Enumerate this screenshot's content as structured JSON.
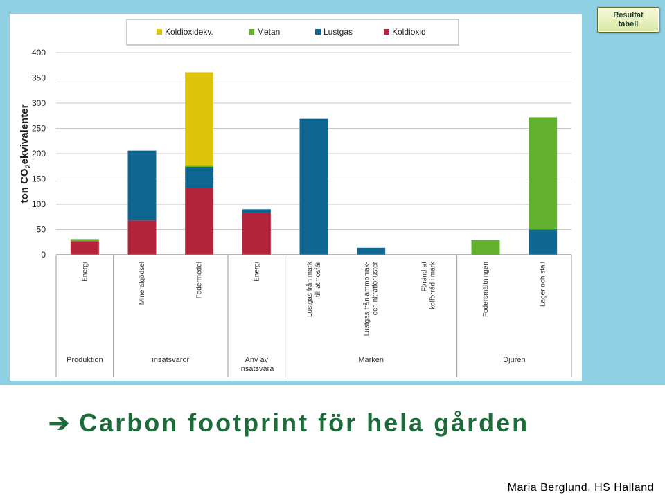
{
  "button": {
    "label": "Resultat\ntabell"
  },
  "slide": {
    "title_arrow": "➔",
    "title": "Carbon footprint för hela gården",
    "author": "Maria Berglund, HS Halland"
  },
  "chart_data": {
    "type": "bar",
    "stacked": true,
    "ylabel_prefix": "ton CO",
    "ylabel_sub": "2",
    "ylabel_suffix": "ekvivalenter",
    "ylim": [
      0,
      400
    ],
    "yticks": [
      0,
      50,
      100,
      150,
      200,
      250,
      300,
      350,
      400
    ],
    "grid": true,
    "legend_position": "top",
    "categories": [
      "Energi",
      "Mineralgödsel",
      "Fodermedel",
      "Energi",
      "Lustgas från mark till atmosfär",
      "Lustgas från ammoniak- och nitratförluster",
      "Förändrat kolförråd i mark",
      "Fodersmältningen",
      "Lager och stall"
    ],
    "category_lines": [
      [
        "Energi"
      ],
      [
        "Mineralgödsel"
      ],
      [
        "Fodermedel"
      ],
      [
        "Energi"
      ],
      [
        "Lustgas från mark",
        "till atmosfär"
      ],
      [
        "Lustgas från ammoniak-",
        "och nitratförluster"
      ],
      [
        "Förändrat",
        "kolförråd i mark"
      ],
      [
        "Fodersmältningen"
      ],
      [
        "Lager och stall"
      ]
    ],
    "groups": [
      {
        "lines": [
          "Produktion"
        ],
        "span": 1
      },
      {
        "lines": [
          "insatsvaror"
        ],
        "span": 2
      },
      {
        "lines": [
          "Anv av",
          "insatsvara"
        ],
        "span": 1
      },
      {
        "lines": [
          "Marken"
        ],
        "span": 3
      },
      {
        "lines": [
          "Djuren"
        ],
        "span": 2
      }
    ],
    "series": [
      {
        "name": "Koldioxid",
        "color": "#b3233a",
        "values": [
          27,
          68,
          132,
          83,
          0,
          0,
          0,
          0,
          0
        ]
      },
      {
        "name": "Lustgas",
        "color": "#0f6690",
        "values": [
          0,
          138,
          42,
          7,
          269,
          14,
          0,
          0,
          50
        ]
      },
      {
        "name": "Metan",
        "color": "#63b22e",
        "values": [
          4,
          0,
          2,
          0,
          0,
          0,
          0,
          29,
          222
        ]
      },
      {
        "name": "Koldioxidekv.",
        "color": "#dec50a",
        "values": [
          0,
          0,
          185,
          0,
          0,
          0,
          0,
          0,
          0
        ]
      }
    ],
    "legend_order": [
      "Koldioxidekv.",
      "Metan",
      "Lustgas",
      "Koldioxid"
    ]
  }
}
